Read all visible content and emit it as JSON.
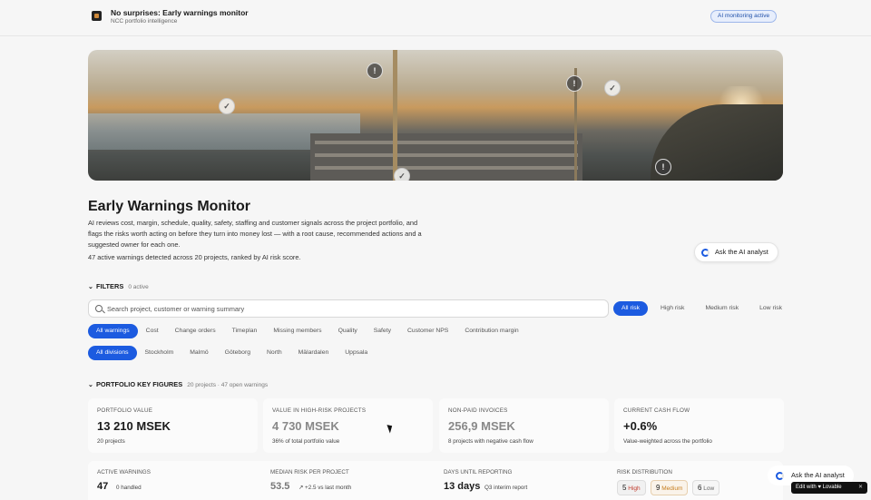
{
  "header": {
    "title": "No surprises: Early warnings monitor",
    "subtitle": "NCC portfolio intelligence",
    "badge": "AI monitoring active"
  },
  "hero": {
    "markers": [
      "check",
      "warning",
      "warning",
      "check",
      "check",
      "warning"
    ]
  },
  "intro": {
    "title": "Early Warnings Monitor",
    "description": "AI reviews cost, margin, schedule, quality, safety, staffing and customer signals across the project portfolio, and flags the risks worth acting on before they turn into money lost — with a root cause, recommended actions and a suggested owner for each one.",
    "summary": "47 active warnings detected across 20 projects, ranked by AI risk score.",
    "ask_label": "Ask the AI analyst"
  },
  "filters": {
    "heading": "FILTERS",
    "active_count": "0 active",
    "search_placeholder": "Search project, customer or warning summary",
    "risk_levels": [
      "All risk",
      "High risk",
      "Medium risk",
      "Low risk"
    ],
    "warning_types": [
      "All warnings",
      "Cost",
      "Change orders",
      "Timeplan",
      "Missing members",
      "Quality",
      "Safety",
      "Customer NPS",
      "Contribution margin"
    ],
    "divisions": [
      "All divisions",
      "Stockholm",
      "Malmö",
      "Göteborg",
      "North",
      "Mälardalen",
      "Uppsala"
    ]
  },
  "key_figures": {
    "heading": "PORTFOLIO KEY FIGURES",
    "sub": "20 projects · 47 open warnings",
    "cards": [
      {
        "label": "PORTFOLIO VALUE",
        "value": "13 210 MSEK",
        "note": "20 projects"
      },
      {
        "label": "VALUE IN HIGH-RISK PROJECTS",
        "value": "4 730 MSEK",
        "note": "36% of total portfolio value"
      },
      {
        "label": "NON-PAID INVOICES",
        "value": "256,9 MSEK",
        "note": "8 projects with negative cash flow"
      },
      {
        "label": "CURRENT CASH FLOW",
        "value": "+0.6%",
        "note": "Value-weighted across the portfolio"
      }
    ]
  },
  "stats": {
    "active_warnings": {
      "label": "ACTIVE WARNINGS",
      "value": "47",
      "note": "0 handled"
    },
    "median_risk": {
      "label": "MEDIAN RISK PER PROJECT",
      "value": "53.5",
      "note": "↗ +2.5 vs last month"
    },
    "days_until": {
      "label": "DAYS UNTIL REPORTING",
      "value": "13 days",
      "note": "Q3 interim report"
    },
    "risk_distribution": {
      "label": "RISK DISTRIBUTION",
      "chips": [
        {
          "count": "5",
          "level": "High"
        },
        {
          "count": "9",
          "level": "Medium"
        },
        {
          "count": "6",
          "level": "Low"
        }
      ]
    }
  },
  "floating": {
    "ask_label": "Ask the AI analyst",
    "lovable": "Edit with ♥ Lovable",
    "close": "✕"
  },
  "colors": {
    "accent": "#1c5be0",
    "high": "#c0392b",
    "medium": "#c77d1f"
  }
}
